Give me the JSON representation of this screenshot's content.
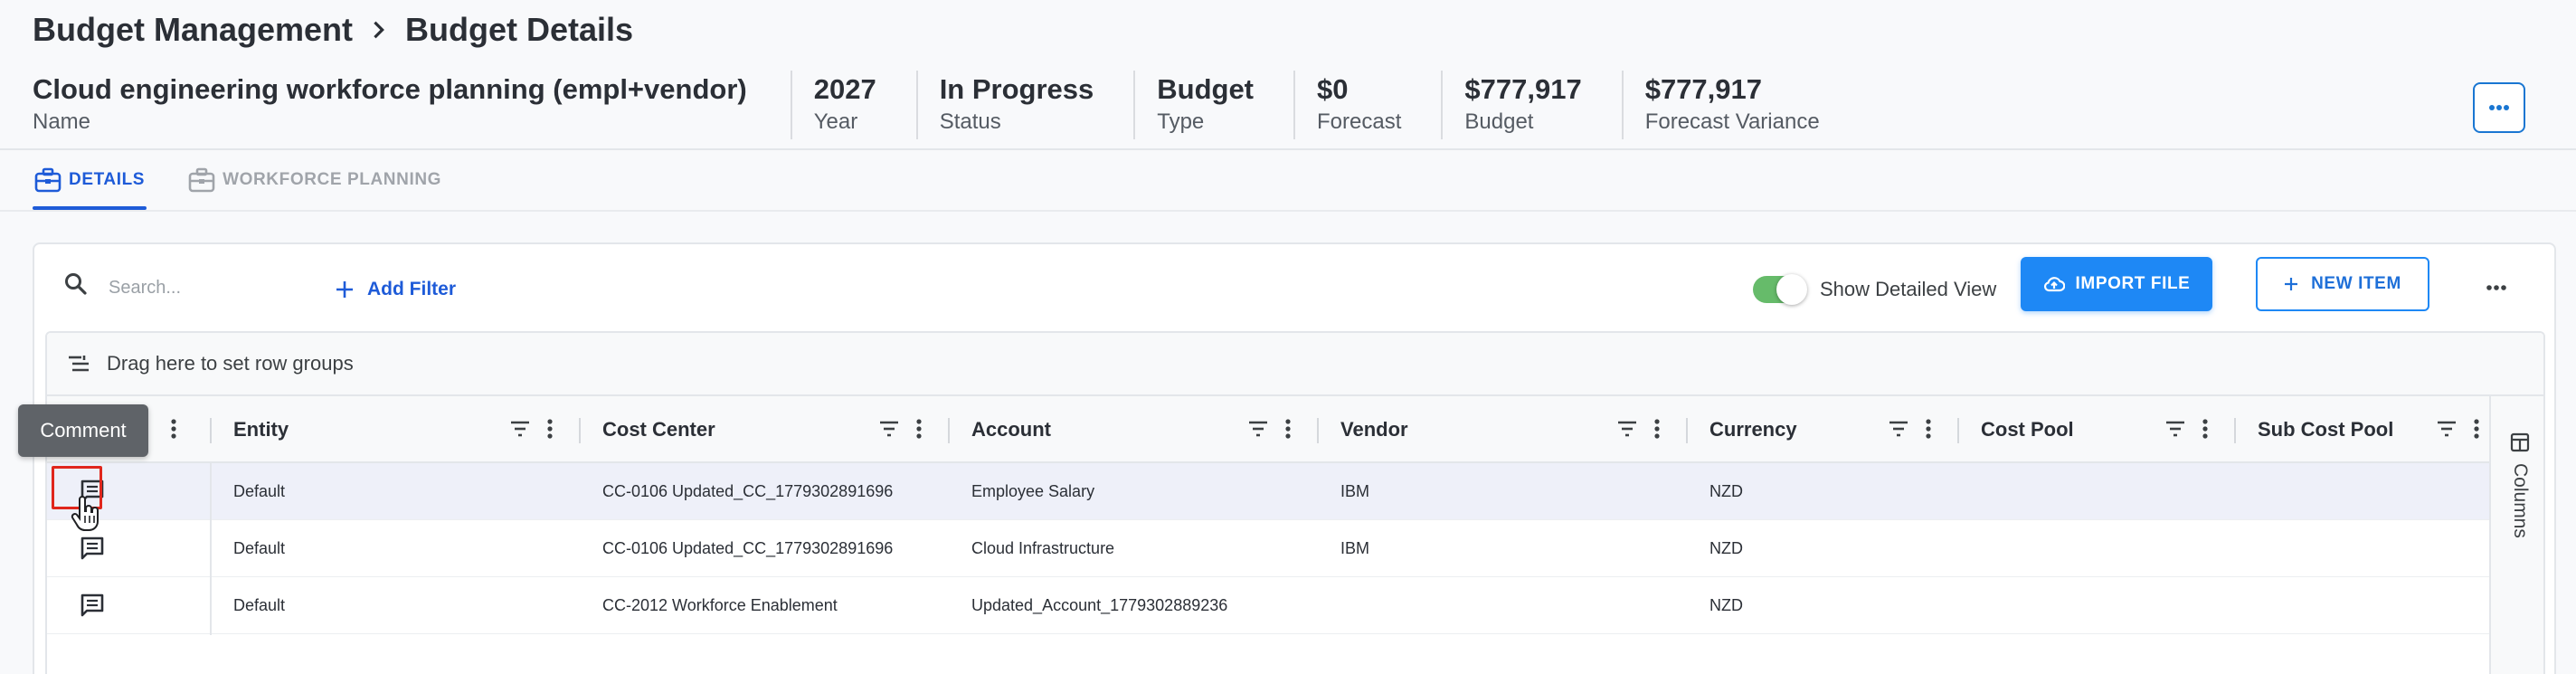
{
  "breadcrumb": {
    "parent": "Budget Management",
    "current": "Budget Details"
  },
  "summary": [
    {
      "value": "Cloud engineering workforce planning (empl+vendor)",
      "label": "Name"
    },
    {
      "value": "2027",
      "label": "Year"
    },
    {
      "value": "In Progress",
      "label": "Status"
    },
    {
      "value": "Budget",
      "label": "Type"
    },
    {
      "value": "$0",
      "label": "Forecast"
    },
    {
      "value": "$777,917",
      "label": "Budget"
    },
    {
      "value": "$777,917",
      "label": "Forecast Variance"
    }
  ],
  "tabs": [
    {
      "label": "DETAILS",
      "icon": "briefcase-icon",
      "active": true
    },
    {
      "label": "WORKFORCE PLANNING",
      "icon": "briefcase-icon",
      "active": false
    }
  ],
  "toolbar": {
    "search_placeholder": "Search...",
    "add_filter_label": "Add Filter",
    "toggle_label": "Show Detailed View",
    "toggle_on": true,
    "import_label": "IMPORT FILE",
    "new_item_label": "NEW ITEM"
  },
  "grid": {
    "group_bar_label": "Drag here to set row groups",
    "columns": [
      "Entity",
      "Cost Center",
      "Account",
      "Vendor",
      "Currency",
      "Cost Pool",
      "Sub Cost Pool"
    ],
    "rows": [
      {
        "entity": "Default",
        "cost_center": "CC-0106 Updated_CC_1779302891696",
        "account": "Employee Salary",
        "vendor": "IBM",
        "currency": "NZD"
      },
      {
        "entity": "Default",
        "cost_center": "CC-0106 Updated_CC_1779302891696",
        "account": "Cloud Infrastructure",
        "vendor": "IBM",
        "currency": "NZD"
      },
      {
        "entity": "Default",
        "cost_center": "CC-2012 Workforce Enablement",
        "account": "Updated_Account_1779302889236",
        "vendor": "",
        "currency": "NZD"
      }
    ],
    "side_panel_label": "Columns"
  },
  "tooltip": {
    "text": "Comment"
  },
  "colors": {
    "accent": "#1e5bd8",
    "button": "#1e88f5",
    "toggle": "#66bb6a",
    "highlight": "#e0261c"
  }
}
